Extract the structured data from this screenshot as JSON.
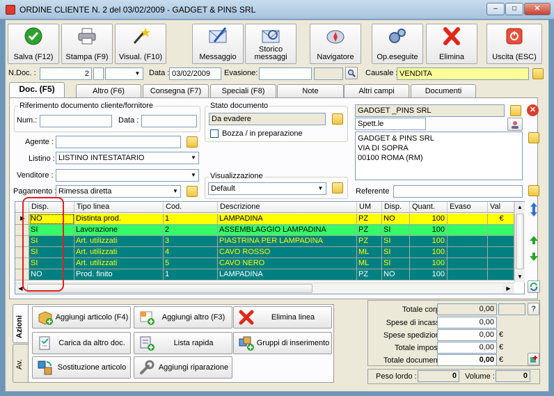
{
  "window": {
    "title": "ORDINE CLIENTE N. 2  del 03/02/2009 - GADGET & PINS SRL",
    "minimize": "–",
    "maximize": "□",
    "close": "✕"
  },
  "toolbar": [
    {
      "label": "Salva (F12)",
      "icon": "check-icon"
    },
    {
      "label": "Stampa (F9)",
      "icon": "printer-icon"
    },
    {
      "label": "Visual. (F10)",
      "icon": "magic-wand-icon"
    },
    {
      "label": "Messaggio",
      "icon": "message-icon"
    },
    {
      "label": "Storico messaggi",
      "icon": "message-history-icon"
    },
    {
      "label": "Navigatore",
      "icon": "compass-icon"
    },
    {
      "label": "Op.eseguite",
      "icon": "gears-icon"
    },
    {
      "label": "Elimina",
      "icon": "delete-icon"
    },
    {
      "label": "Uscita (ESC)",
      "icon": "exit-icon"
    }
  ],
  "header": {
    "ndoc_label": "N.Doc. :",
    "ndoc_value": "2",
    "data_label": "Data :",
    "data_value": "03/02/2009",
    "evasione_label": "Evasione:",
    "causale_label": "Causale :",
    "causale_value": "VENDITA"
  },
  "tabs": [
    "Doc. (F5)",
    "Altro (F6)",
    "Consegna (F7)",
    "Speciali (F8)",
    "Note",
    "Altri campi",
    "Documenti"
  ],
  "doc": {
    "rif_title": "Riferimento documento cliente/fornitore",
    "num_label": "Num.:",
    "data_label": "Data :",
    "stato_title": "Stato documento",
    "stato_value": "Da evadere",
    "bozza_label": "Bozza / in preparazione",
    "agente_label": "Agente :",
    "listino_label": "Listino :",
    "listino_value": "LISTINO INTESTATARIO",
    "venditore_label": "Venditore :",
    "pagamento_label": "Pagamento :",
    "pagamento_value": "Rimessa diretta",
    "visual_title": "Visualizzazione",
    "visual_value": "Default",
    "customer_name": "GADGET _PINS SRL",
    "salutation": "Spett.le",
    "address_lines": [
      "GADGET & PINS SRL",
      "VIA DI SOPRA",
      "00100 ROMA (RM)"
    ],
    "referente_label": "Referente"
  },
  "grid": {
    "columns": [
      "Disp.",
      "Tipo linea",
      "Cod.",
      "Descrizione",
      "UM",
      "Disp.",
      "Quant.",
      "Evaso",
      "Val"
    ],
    "rows": [
      {
        "disp": "NO",
        "tipo": "Distinta prod.",
        "cod": "1",
        "desc": "LAMPADINA",
        "um": "PZ",
        "disp2": "NO",
        "quant": "100",
        "evaso": "",
        "val": "€",
        "bg": "#ffff00",
        "fg": "#000000"
      },
      {
        "disp": "SI",
        "tipo": "Lavorazione",
        "cod": "2",
        "desc": "ASSEMBLAGGIO LAMPADINA",
        "um": "PZ",
        "disp2": "SI",
        "quant": "100",
        "evaso": "",
        "val": "",
        "bg": "#33ff66",
        "fg": "#000000"
      },
      {
        "disp": "SI",
        "tipo": "Art. utilizzati",
        "cod": "3",
        "desc": "PIASTRINA PER LAMPADINA",
        "um": "PZ",
        "disp2": "SI",
        "quant": "100",
        "evaso": "",
        "val": "",
        "bg": "#008080",
        "fg": "#ffff00"
      },
      {
        "disp": "SI",
        "tipo": "Art. utilizzati",
        "cod": "4",
        "desc": "CAVO ROSSO",
        "um": "ML",
        "disp2": "SI",
        "quant": "100",
        "evaso": "",
        "val": "",
        "bg": "#008080",
        "fg": "#ffff00"
      },
      {
        "disp": "SI",
        "tipo": "Art. utilizzati",
        "cod": "5",
        "desc": "CAVO NERO",
        "um": "ML",
        "disp2": "SI",
        "quant": "100",
        "evaso": "",
        "val": "",
        "bg": "#008080",
        "fg": "#ffff00"
      },
      {
        "disp": "NO",
        "tipo": "Prod. finito",
        "cod": "1",
        "desc": "LAMPADINA",
        "um": "PZ",
        "disp2": "NO",
        "quant": "100",
        "evaso": "",
        "val": "",
        "bg": "#008080",
        "fg": "#ffffff"
      }
    ]
  },
  "actions": {
    "side_tabs": [
      "Azioni",
      "Av."
    ],
    "buttons": [
      {
        "label": "Aggiungi articolo (F4)",
        "icon": "add-article-icon"
      },
      {
        "label": "Aggiungi altro (F3)",
        "icon": "add-other-icon"
      },
      {
        "label": "Elimina linea",
        "icon": "delete-line-icon"
      },
      {
        "label": "Carica da altro doc.",
        "icon": "load-doc-icon"
      },
      {
        "label": "Lista rapida",
        "icon": "quick-list-icon"
      },
      {
        "label": "Gruppi di inserimento",
        "icon": "insert-groups-icon"
      },
      {
        "label": "Sostituzione articolo",
        "icon": "replace-article-icon"
      },
      {
        "label": "Aggiungi riparazione",
        "icon": "wrench-icon"
      }
    ]
  },
  "totals": {
    "corpo_label": "Totale corpo :",
    "corpo_value": "0,00",
    "incasso_label": "Spese di incasso :",
    "incasso_value": "0,00",
    "spedizione_label": "Spese spedizione :",
    "spedizione_value": "0,00",
    "imposte_label": "Totale imposte :",
    "imposte_value": "0,00",
    "documento_label": "Totale documento :",
    "documento_value": "0,00",
    "currency": "€",
    "help": "?",
    "peso_label": "Peso lordo :",
    "peso_value": "0",
    "volume_label": "Volume :",
    "volume_value": "0"
  },
  "colors": {
    "accent_red_box": "#e02020",
    "header_yellow": "#ffff99",
    "teal_row": "#008080"
  }
}
